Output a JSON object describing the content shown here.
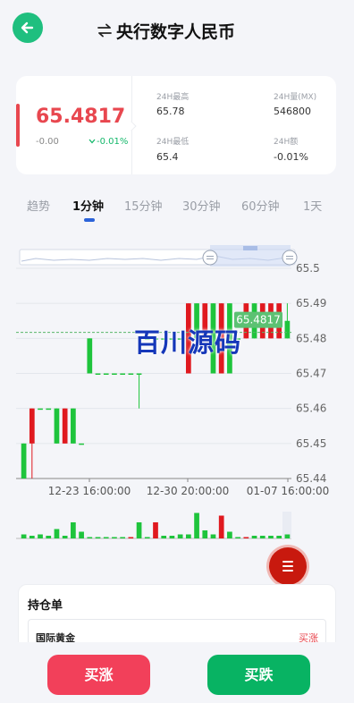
{
  "header": {
    "title": "央行数字人民币",
    "back_icon": "back-arrow-icon",
    "switch_icon": "swap-arrows-icon",
    "accent": "#1fbf7f"
  },
  "quote": {
    "price": "65.4817",
    "change": "-0.00",
    "change_pct": "-0.01%",
    "high_label": "24H最高",
    "high": "65.78",
    "volume_label": "24H量(MX)",
    "volume": "546800",
    "low_label": "24H最低",
    "low": "65.4",
    "amount_label": "24H额",
    "amount": "-0.01%"
  },
  "tabs": [
    {
      "label": "趋势",
      "active": false
    },
    {
      "label": "1分钟",
      "active": true
    },
    {
      "label": "15分钟",
      "active": false
    },
    {
      "label": "30分钟",
      "active": false
    },
    {
      "label": "60分钟",
      "active": false
    },
    {
      "label": "1天",
      "active": false
    }
  ],
  "watermark": "百川源码",
  "chart_data": {
    "type": "candlestick",
    "y_ticks": [
      "65.5",
      "65.49",
      "65.48",
      "65.47",
      "65.46",
      "65.45",
      "65.44"
    ],
    "ylim": [
      65.44,
      65.5
    ],
    "x_ticks": [
      "12-23 16:00:00",
      "12-30 20:00:00",
      "01-07 16:00:00"
    ],
    "current_price_label": "65.4817",
    "up_color": "#e0191f",
    "down_color": "#1ec43c",
    "candles": [
      {
        "o": 65.45,
        "h": 65.45,
        "l": 65.44,
        "c": 65.44
      },
      {
        "o": 65.45,
        "h": 65.46,
        "l": 65.44,
        "c": 65.46
      },
      {
        "o": 65.46,
        "h": 65.46,
        "l": 65.46,
        "c": 65.46
      },
      {
        "o": 65.46,
        "h": 65.46,
        "l": 65.46,
        "c": 65.46
      },
      {
        "o": 65.46,
        "h": 65.46,
        "l": 65.45,
        "c": 65.45
      },
      {
        "o": 65.45,
        "h": 65.46,
        "l": 65.45,
        "c": 65.46
      },
      {
        "o": 65.46,
        "h": 65.46,
        "l": 65.45,
        "c": 65.45
      },
      {
        "o": 65.45,
        "h": 65.45,
        "l": 65.45,
        "c": 65.45
      },
      {
        "o": 65.48,
        "h": 65.48,
        "l": 65.47,
        "c": 65.47
      },
      {
        "o": 65.47,
        "h": 65.47,
        "l": 65.47,
        "c": 65.47
      },
      {
        "o": 65.47,
        "h": 65.47,
        "l": 65.47,
        "c": 65.47
      },
      {
        "o": 65.47,
        "h": 65.47,
        "l": 65.47,
        "c": 65.47
      },
      {
        "o": 65.47,
        "h": 65.47,
        "l": 65.47,
        "c": 65.47
      },
      {
        "o": 65.47,
        "h": 65.47,
        "l": 65.47,
        "c": 65.47
      },
      {
        "o": 65.47,
        "h": 65.47,
        "l": 65.46,
        "c": 65.47
      },
      {
        "o": 65.48,
        "h": 65.48,
        "l": 65.48,
        "c": 65.48
      },
      {
        "o": 65.48,
        "h": 65.48,
        "l": 65.48,
        "c": 65.48
      },
      {
        "o": 65.48,
        "h": 65.48,
        "l": 65.48,
        "c": 65.48
      },
      {
        "o": 65.48,
        "h": 65.48,
        "l": 65.48,
        "c": 65.48
      },
      {
        "o": 65.48,
        "h": 65.48,
        "l": 65.48,
        "c": 65.48
      },
      {
        "o": 65.47,
        "h": 65.49,
        "l": 65.47,
        "c": 65.49
      },
      {
        "o": 65.49,
        "h": 65.49,
        "l": 65.48,
        "c": 65.48
      },
      {
        "o": 65.48,
        "h": 65.49,
        "l": 65.48,
        "c": 65.49
      },
      {
        "o": 65.49,
        "h": 65.49,
        "l": 65.47,
        "c": 65.47
      },
      {
        "o": 65.47,
        "h": 65.49,
        "l": 65.47,
        "c": 65.49
      },
      {
        "o": 65.49,
        "h": 65.49,
        "l": 65.47,
        "c": 65.47
      },
      {
        "o": 65.48,
        "h": 65.48,
        "l": 65.48,
        "c": 65.48
      },
      {
        "o": 65.48,
        "h": 65.49,
        "l": 65.48,
        "c": 65.49
      },
      {
        "o": 65.49,
        "h": 65.49,
        "l": 65.48,
        "c": 65.48
      },
      {
        "o": 65.48,
        "h": 65.49,
        "l": 65.48,
        "c": 65.49
      },
      {
        "o": 65.48,
        "h": 65.49,
        "l": 65.48,
        "c": 65.49
      },
      {
        "o": 65.48,
        "h": 65.49,
        "l": 65.48,
        "c": 65.49
      },
      {
        "o": 65.485,
        "h": 65.49,
        "l": 65.48,
        "c": 65.48
      }
    ],
    "volumes": [
      {
        "v": 0.15,
        "up": false
      },
      {
        "v": 0.1,
        "up": false
      },
      {
        "v": 0.15,
        "up": false
      },
      {
        "v": 0.1,
        "up": false
      },
      {
        "v": 0.35,
        "up": false
      },
      {
        "v": 0.1,
        "up": false
      },
      {
        "v": 0.6,
        "up": false
      },
      {
        "v": 0.25,
        "up": false
      },
      {
        "v": 0.05,
        "up": false
      },
      {
        "v": 0.05,
        "up": false
      },
      {
        "v": 0.05,
        "up": false
      },
      {
        "v": 0.05,
        "up": false
      },
      {
        "v": 0.05,
        "up": false
      },
      {
        "v": 0.05,
        "up": true
      },
      {
        "v": 0.6,
        "up": false
      },
      {
        "v": 0.05,
        "up": false
      },
      {
        "v": 0.6,
        "up": true
      },
      {
        "v": 0.1,
        "up": false
      },
      {
        "v": 0.1,
        "up": false
      },
      {
        "v": 0.15,
        "up": false
      },
      {
        "v": 0.15,
        "up": false
      },
      {
        "v": 0.95,
        "up": false
      },
      {
        "v": 0.3,
        "up": false
      },
      {
        "v": 0.15,
        "up": false
      },
      {
        "v": 0.85,
        "up": true
      },
      {
        "v": 0.25,
        "up": false
      },
      {
        "v": 0.05,
        "up": false
      },
      {
        "v": 0.05,
        "up": true
      },
      {
        "v": 0.1,
        "up": false
      },
      {
        "v": 0.1,
        "up": false
      },
      {
        "v": 0.1,
        "up": false
      },
      {
        "v": 0.1,
        "up": false
      },
      {
        "v": 0.15,
        "up": false
      }
    ]
  },
  "position": {
    "title": "持仓单",
    "items": [
      {
        "name": "国际黄金",
        "direction": "买涨"
      }
    ]
  },
  "actions": {
    "buy_up": "买涨",
    "buy_down": "买跌"
  }
}
